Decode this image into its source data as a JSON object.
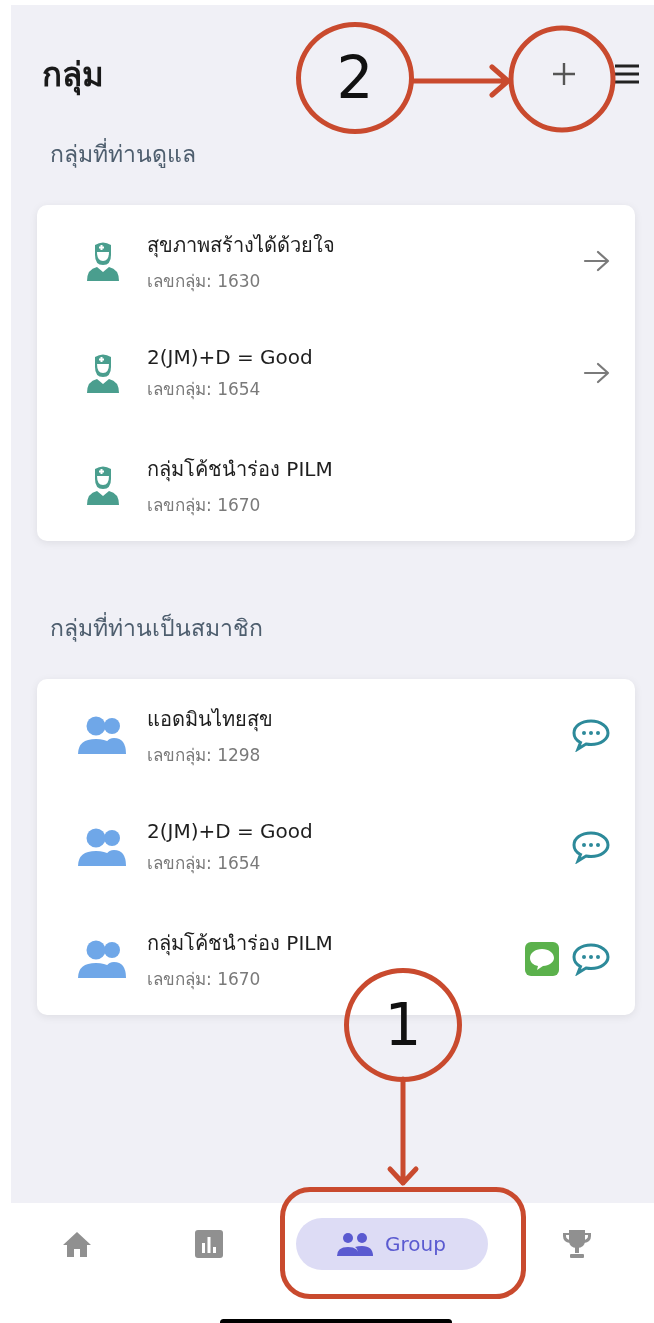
{
  "header": {
    "title": "กลุ่ม"
  },
  "sections": [
    {
      "kind": "managed",
      "title": "กลุ่มที่ท่านดูแล",
      "groups": [
        {
          "name": "สุขภาพสร้างได้ด้วยใจ",
          "number": "เลขกลุ่ม: 1630",
          "actions": [
            {
              "kind": "arrow"
            }
          ]
        },
        {
          "name": "2(JM)+D = Good",
          "number": "เลขกลุ่ม: 1654",
          "actions": [
            {
              "kind": "arrow"
            }
          ]
        },
        {
          "name": "กลุ่มโค้ชนำร่อง PILM",
          "number": "เลขกลุ่ม: 1670"
        }
      ]
    },
    {
      "kind": "member",
      "title": "กลุ่มที่ท่านเป็นสมาชิก",
      "groups": [
        {
          "name": "แอดมินไทยสุข",
          "number": "เลขกลุ่ม: 1298",
          "actions": [
            {
              "kind": "chat"
            }
          ]
        },
        {
          "name": "2(JM)+D = Good",
          "number": "เลขกลุ่ม: 1654",
          "actions": [
            {
              "kind": "chat"
            }
          ]
        },
        {
          "name": "กลุ่มโค้ชนำร่อง PILM",
          "number": "เลขกลุ่ม: 1670",
          "actions": [
            {
              "kind": "line"
            },
            {
              "kind": "chat"
            }
          ]
        }
      ]
    }
  ],
  "tabs": [
    {
      "kind": "home",
      "selected": false
    },
    {
      "kind": "stats",
      "selected": false
    },
    {
      "kind": "group",
      "label": "Group",
      "selected": true
    },
    {
      "kind": "trophy",
      "selected": false
    }
  ],
  "annotations": [
    {
      "label": "2"
    },
    {
      "label": "1"
    }
  ]
}
